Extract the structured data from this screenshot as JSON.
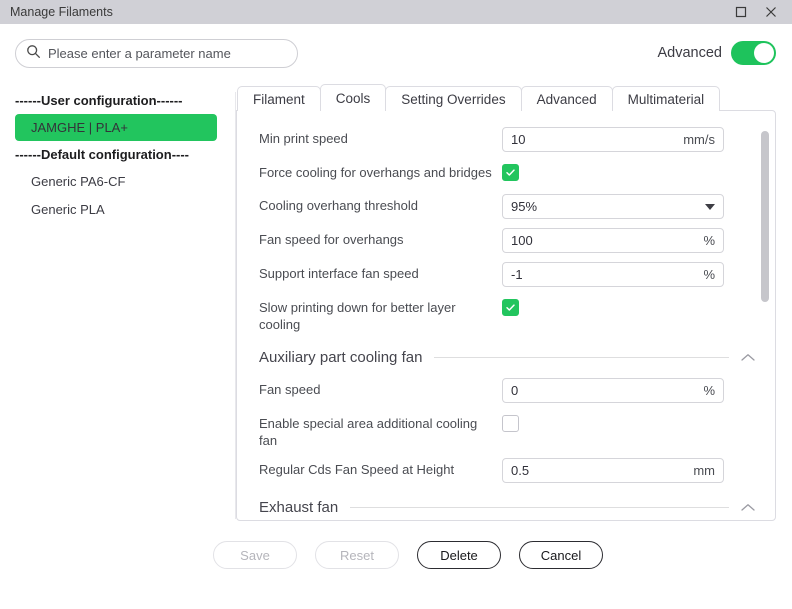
{
  "window": {
    "title": "Manage Filaments",
    "controls": [
      {
        "name": "maximize-button",
        "glyph": "maximize"
      },
      {
        "name": "close-button",
        "glyph": "close"
      }
    ]
  },
  "search": {
    "placeholder": "Please enter a parameter name",
    "value": "",
    "icon": "search-icon"
  },
  "advanced": {
    "label": "Advanced",
    "enabled": true,
    "accent_color": "#1ec35c"
  },
  "sidebar": {
    "groups": [
      {
        "header": "------User configuration------",
        "items": [
          {
            "label": "JAMGHE | PLA+",
            "selected": true
          }
        ]
      },
      {
        "header": "------Default configuration----",
        "items": [
          {
            "label": "Generic PA6-CF",
            "selected": false
          },
          {
            "label": "Generic PLA",
            "selected": false
          }
        ]
      }
    ],
    "selected_color": "#22c55e"
  },
  "tabs": [
    {
      "label": "Filament",
      "active": false
    },
    {
      "label": "Cools",
      "active": true
    },
    {
      "label": "Setting Overrides",
      "active": false
    },
    {
      "label": "Advanced",
      "active": false
    },
    {
      "label": "Multimaterial",
      "active": false
    }
  ],
  "form": {
    "rows": [
      {
        "label": "Min print speed",
        "type": "text",
        "value": "10",
        "unit": "mm/s"
      },
      {
        "label": "Force cooling for overhangs and bridges",
        "type": "checkbox",
        "checked": true
      },
      {
        "label": "Cooling overhang threshold",
        "type": "select",
        "value": "95%",
        "unit": ""
      },
      {
        "label": "Fan speed for overhangs",
        "type": "text",
        "value": "100",
        "unit": "%"
      },
      {
        "label": "Support interface fan speed",
        "type": "text",
        "value": "-1",
        "unit": "%"
      },
      {
        "label": "Slow printing down for better layer cooling",
        "type": "checkbox",
        "checked": true
      }
    ],
    "sections": [
      {
        "title": "Auxiliary part cooling fan",
        "collapsed": false,
        "rows": [
          {
            "label": "Fan speed",
            "type": "text",
            "value": "0",
            "unit": "%"
          },
          {
            "label": "Enable special area additional cooling fan",
            "type": "checkbox",
            "checked": false
          },
          {
            "label": "Regular Cds Fan Speed at Height",
            "type": "text",
            "value": "0.5",
            "unit": "mm"
          }
        ]
      },
      {
        "title": "Exhaust fan",
        "collapsed": false,
        "rows": []
      }
    ]
  },
  "footer": {
    "buttons": [
      {
        "label": "Save",
        "enabled": false,
        "emphasis": false
      },
      {
        "label": "Reset",
        "enabled": false,
        "emphasis": false
      },
      {
        "label": "Delete",
        "enabled": true,
        "emphasis": true
      },
      {
        "label": "Cancel",
        "enabled": true,
        "emphasis": true
      }
    ]
  }
}
